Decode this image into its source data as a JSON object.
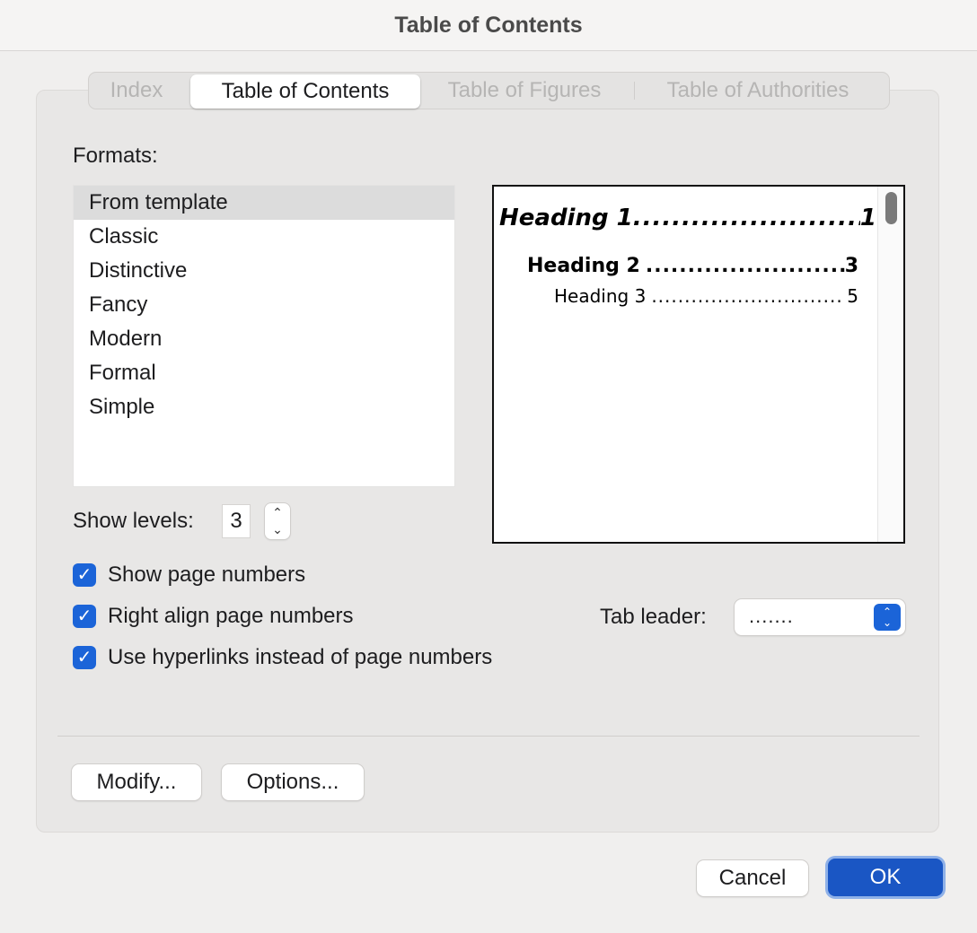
{
  "window": {
    "title": "Table of Contents"
  },
  "tabs": [
    {
      "label": "Index",
      "active": false
    },
    {
      "label": "Table of Contents",
      "active": true
    },
    {
      "label": "Table of Figures",
      "active": false
    },
    {
      "label": "Table of Authorities",
      "active": false
    }
  ],
  "formats": {
    "label": "Formats:",
    "items": [
      "From template",
      "Classic",
      "Distinctive",
      "Fancy",
      "Modern",
      "Formal",
      "Simple"
    ],
    "selected": "From template"
  },
  "preview": {
    "entries": [
      {
        "text": "Heading 1",
        "page": "1"
      },
      {
        "text": "Heading 2",
        "page": "3"
      },
      {
        "text": "Heading 3",
        "page": "5"
      }
    ]
  },
  "show_levels": {
    "label": "Show levels:",
    "value": "3"
  },
  "options": {
    "show_page_numbers": {
      "label": "Show page numbers",
      "checked": true
    },
    "right_align": {
      "label": "Right align page numbers",
      "checked": true
    },
    "hyperlinks": {
      "label": "Use hyperlinks instead of page numbers",
      "checked": true
    }
  },
  "tab_leader": {
    "label": "Tab leader:",
    "value": "......."
  },
  "buttons": {
    "modify": "Modify...",
    "options": "Options...",
    "cancel": "Cancel",
    "ok": "OK"
  },
  "colors": {
    "accent": "#1b64d8",
    "ok_button": "#1a56c4"
  }
}
